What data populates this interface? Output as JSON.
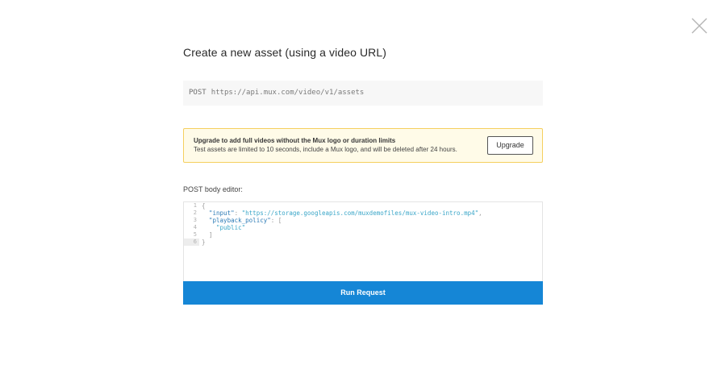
{
  "dialog": {
    "title": "Create a new asset (using a video URL)",
    "close_icon": "close-icon"
  },
  "endpoint": {
    "method": "POST",
    "url": "https://api.mux.com/video/v1/assets"
  },
  "notice": {
    "title": "Upgrade to add full videos without the Mux logo or duration limits",
    "body": "Test assets are limited to 10 seconds, include a Mux logo, and will be deleted after 24 hours.",
    "button_label": "Upgrade",
    "border_color": "#f5cf5f",
    "background_color": "#fffbe8"
  },
  "editor": {
    "label": "POST body editor:",
    "line_numbers": [
      "1",
      "2",
      "3",
      "4",
      "5",
      "6"
    ],
    "lines": [
      {
        "open": "{"
      },
      {
        "key": "\"input\"",
        "sep": ": ",
        "value": "\"https://storage.googleapis.com/muxdemofiles/mux-video-intro.mp4\"",
        "tail": ","
      },
      {
        "key": "\"playback_policy\"",
        "sep": ": ",
        "tail": "["
      },
      {
        "value": "\"public\""
      },
      {
        "close": "]"
      },
      {
        "close": "}"
      }
    ]
  },
  "run_button": {
    "label": "Run Request",
    "color": "#1586d6"
  }
}
